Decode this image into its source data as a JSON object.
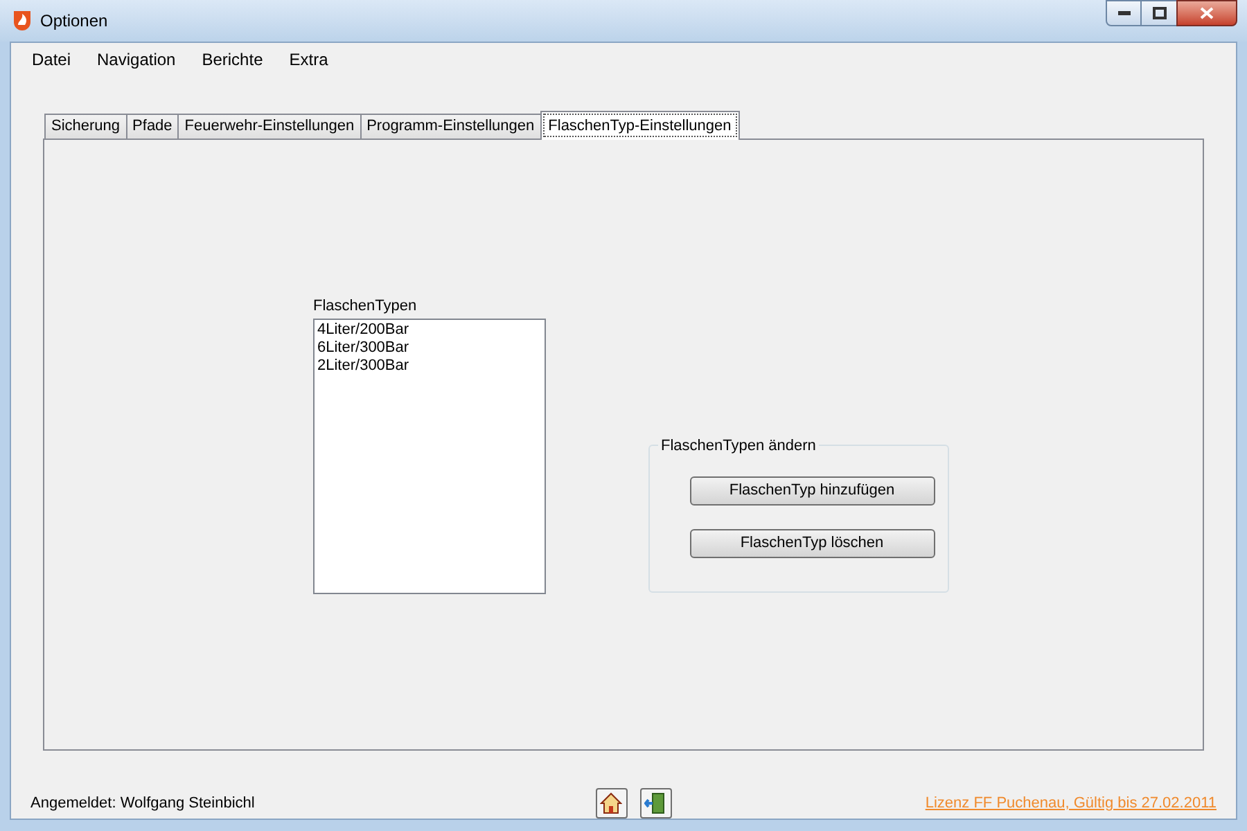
{
  "window": {
    "title": "Optionen"
  },
  "menu": [
    "Datei",
    "Navigation",
    "Berichte",
    "Extra"
  ],
  "tabs": [
    {
      "label": "Sicherung",
      "selected": false
    },
    {
      "label": "Pfade",
      "selected": false
    },
    {
      "label": "Feuerwehr-Einstellungen",
      "selected": false
    },
    {
      "label": "Programm-Einstellungen",
      "selected": false
    },
    {
      "label": "FlaschenTyp-Einstellungen",
      "selected": true
    }
  ],
  "list": {
    "label": "FlaschenTypen",
    "items": [
      "4Liter/200Bar",
      "6Liter/300Bar",
      "2Liter/300Bar"
    ]
  },
  "group": {
    "title": "FlaschenTypen ändern",
    "buttons": [
      "FlaschenTyp hinzufügen",
      "FlaschenTyp löschen"
    ]
  },
  "status_bar": {
    "user": "Angemeldet: Wolfgang Steinbichl",
    "license": "Lizenz FF Puchenau, Gültig bis 27.02.2011"
  }
}
